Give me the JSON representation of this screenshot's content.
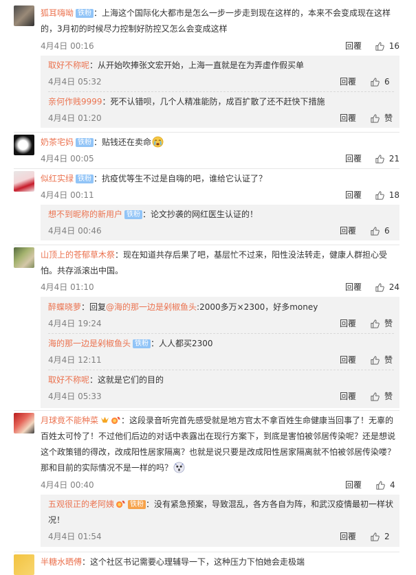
{
  "icons": {
    "like": "thumbs-up-icon",
    "vip": "vip-crown-icon",
    "medal": "fan-medal-icon",
    "sob": "crying-emoji-icon",
    "fear": "fear-emoji-icon"
  },
  "colors": {
    "username": "#eb7350",
    "badge": "#91c4f7",
    "reply_panel": "#f2f2f2",
    "meta": "#808080"
  },
  "reply_label": "回覆",
  "comments": [
    {
      "user": "狐耳嗨呦",
      "badge": "铁粉",
      "text": "：上海这个国际化大都市是怎么一步一步走到现在这样的，本来不会变成现在这样的，3月初的时候尽力控制好防控又怎么会变成这样",
      "time": "4月4日 00:16",
      "likes": "16",
      "replies": [
        {
          "user": "取好不称呢",
          "text": "：从开始吹捧张文宏开始，上海一直就是在为弄虚作假买单",
          "time": "4月4日 05:32",
          "likes": "6"
        },
        {
          "user": "亲何作贱9999",
          "text": "：死不认错呗，几个人精准能防，成百扩散了还不赶快下措施",
          "time": "4月4日 01:20",
          "likes": "赞"
        }
      ]
    },
    {
      "user": "奶茶宅妈",
      "badge": "铁粉",
      "text": "：贴钱还在卖命",
      "time": "4月4日 00:05",
      "likes": "21",
      "replies": []
    },
    {
      "user": "似红实绿",
      "badge": "铁粉",
      "text": "：抗疫优等生不过是自嗨的吧，谁给它认证了？",
      "time": "4月4日 00:11",
      "likes": "18",
      "replies": [
        {
          "user": "想不到昵称的新用户",
          "badge": "铁粉",
          "text": "：论文抄袭的网红医生认证的！",
          "time": "4月4日 00:46",
          "likes": "6"
        }
      ]
    },
    {
      "user": "山顶上的苍郁草木祭",
      "text": "：现在知道共存后果了吧，基层忙不过来，阳性没法转走，健康人群担心受怕。共存派滚出中国。",
      "time": "4月4日 01:10",
      "likes": "24",
      "replies": [
        {
          "user": "醉蝶晓萝",
          "text_prefix": "：回复",
          "mention": "@海的那一边是剁椒鱼头",
          "text": ":2000多万×2300，好多money",
          "time": "4月4日 19:24",
          "likes": "赞"
        },
        {
          "user": "海的那一边是剁椒鱼头",
          "badge": "铁粉",
          "text": "：人人都买2300",
          "time": "4月4日 12:11",
          "likes": "赞"
        },
        {
          "user": "取好不称呢",
          "text": "：这就是它们的目的",
          "time": "4月4日 05:33",
          "likes": "赞"
        }
      ]
    },
    {
      "user": "月球竟不能种菜",
      "text": "：这段录音听完首先感受就是地方官太不拿百姓生命健康当回事了！无辜的百姓太可怜了！不过他们后边的对话中表露出在现行方案下，到底是害怕被邻居传染呢？还是想说这个政策错的得改，改成阳性居家隔离？也就是说只要是改成阳性居家隔离就不怕被邻居传染喽？那和目前的实际情况不是一样的吗？",
      "time": "4月4日 00:40",
      "likes": "4",
      "replies": [
        {
          "user": "五观很正的老阿姨",
          "badge": "铁粉",
          "text": "：没有紧急预案，导致混乱，各方各自为阵，和武汉疫情最初一样状况！",
          "time": "4月4日 01:54",
          "likes": "2"
        }
      ]
    },
    {
      "user": "半糖水晒傅",
      "text": "：这个社区书记需要心理辅导一下，这种压力下怕她会走极端"
    }
  ]
}
